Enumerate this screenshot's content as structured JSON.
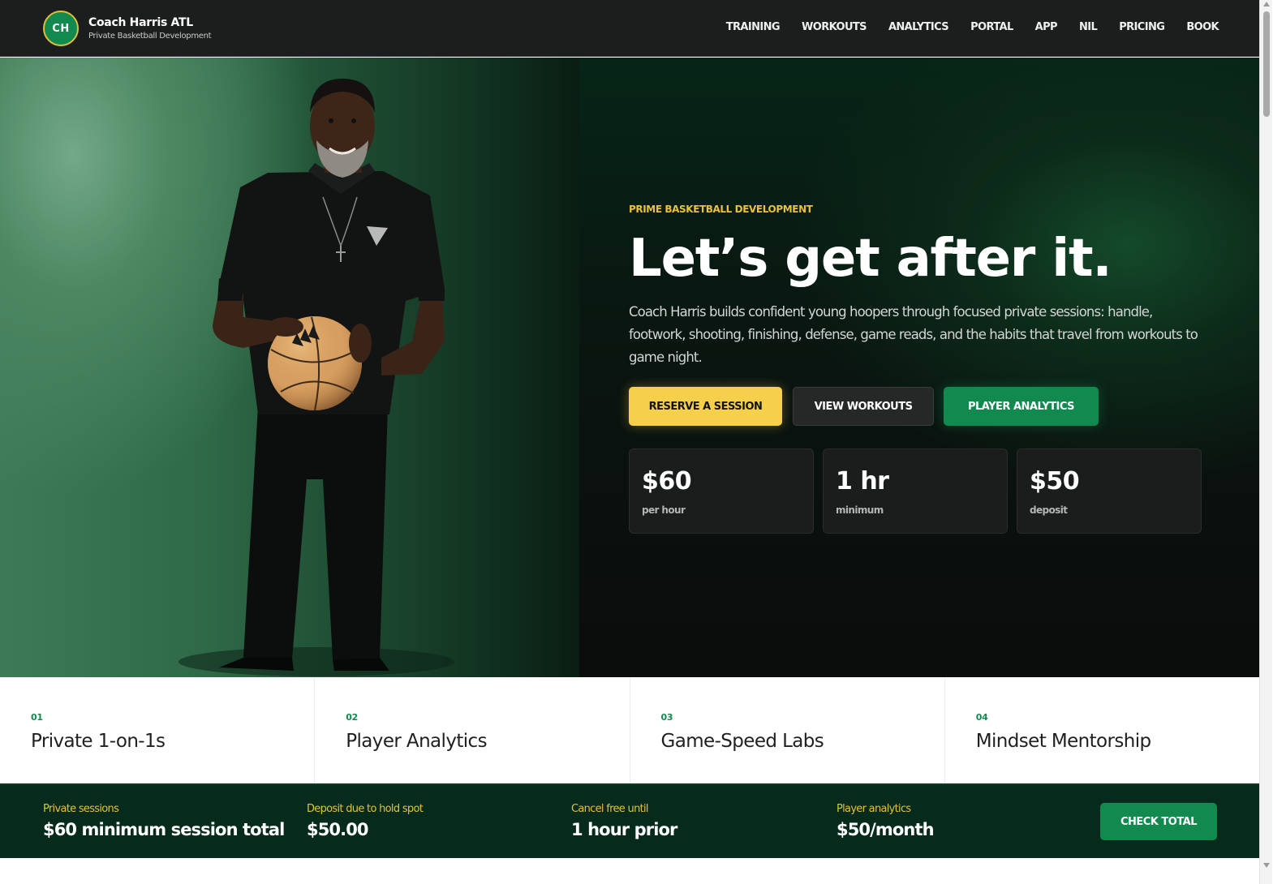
{
  "brand": {
    "initials": "CH",
    "name": "Coach Harris ATL",
    "tagline": "Private Basketball Development"
  },
  "nav": {
    "items": [
      "TRAINING",
      "WORKOUTS",
      "ANALYTICS",
      "PORTAL",
      "APP",
      "NIL",
      "PRICING",
      "BOOK"
    ]
  },
  "hero": {
    "eyebrow": "PRIME BASKETBALL DEVELOPMENT",
    "headline": "Let’s get after it.",
    "lede": "Coach Harris builds confident young hoopers through focused private sessions: handle, footwork, shooting, finishing, defense, game reads, and the habits that travel from workouts to game night.",
    "buttons": {
      "reserve": "RESERVE A SESSION",
      "workouts": "VIEW WORKOUTS",
      "analytics": "PLAYER ANALYTICS"
    },
    "stats": [
      {
        "value": "$60",
        "label": "per hour"
      },
      {
        "value": "1 hr",
        "label": "minimum"
      },
      {
        "value": "$50",
        "label": "deposit"
      }
    ]
  },
  "services": [
    {
      "num": "01",
      "title": "Private 1-on-1s"
    },
    {
      "num": "02",
      "title": "Player Analytics"
    },
    {
      "num": "03",
      "title": "Game-Speed Labs"
    },
    {
      "num": "04",
      "title": "Mindset Mentorship"
    }
  ],
  "infobar": {
    "items": [
      {
        "key": "Private sessions",
        "value": "$60 minimum session total"
      },
      {
        "key": "Deposit due to hold spot",
        "value": "$50.00"
      },
      {
        "key": "Cancel free until",
        "value": "1 hour prior"
      },
      {
        "key": "Player analytics",
        "value": "$50/month"
      }
    ],
    "button": "CHECK TOTAL"
  },
  "colors": {
    "accent_gold": "#f6d04a",
    "accent_green": "#11894f",
    "dark_bg": "#1c1e1e",
    "infobar_bg": "#062b1c"
  }
}
